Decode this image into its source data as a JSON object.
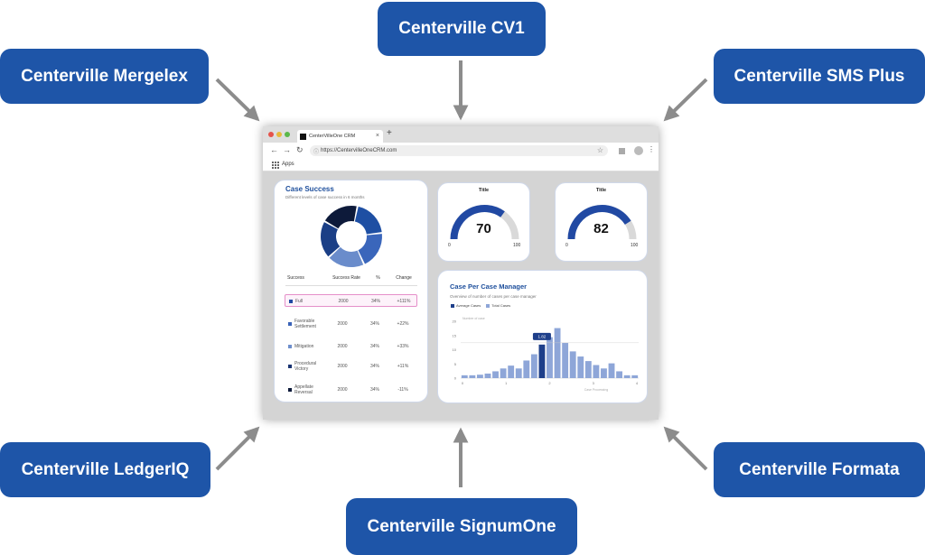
{
  "nodes": {
    "cv1": "Centerville CV1",
    "mergelex": "Centerville Mergelex",
    "sms_plus": "Centerville SMS Plus",
    "ledgeriq": "Centerville LedgerIQ",
    "signumone": "Centerville SignumOne",
    "formata": "Centerville Formata"
  },
  "colors": {
    "node": "#1e55a8",
    "arrow": "#8c8c8c",
    "accent": "#2149a3"
  },
  "browser": {
    "tab_title": "CenterVilleOne CRM",
    "tab_close": "×",
    "new_tab": "+",
    "url": "https://CentervilleOneCRM.com",
    "bookmarks_label": "Apps"
  },
  "case_success": {
    "title": "Case Success",
    "subtitle": "Different levels of case success in 6 months",
    "headers": [
      "Success",
      "Success Rate",
      "%",
      "Change"
    ],
    "rows": [
      {
        "label": "Full",
        "rate": "2000",
        "pct": "34%",
        "change": "+111%",
        "color": "#2149a3"
      },
      {
        "label": "Favorable Settlement",
        "rate": "2000",
        "pct": "34%",
        "change": "+22%",
        "color": "#3a63b8"
      },
      {
        "label": "Mitigation",
        "rate": "2000",
        "pct": "34%",
        "change": "+33%",
        "color": "#6f8fcc"
      },
      {
        "label": "Procedural Victory",
        "rate": "2000",
        "pct": "34%",
        "change": "+11%",
        "color": "#1a3472"
      },
      {
        "label": "Appellate Reversal",
        "rate": "2000",
        "pct": "34%",
        "change": "-11%",
        "color": "#0d1a3a"
      }
    ]
  },
  "gauges": [
    {
      "title": "Title",
      "value": "70",
      "min": "0",
      "max": "100"
    },
    {
      "title": "Title",
      "value": "82",
      "min": "0",
      "max": "100"
    }
  ],
  "case_per_manager": {
    "title": "Case Per Case Manager",
    "subtitle": "Overview of number of cases per case manager",
    "legend": [
      "Average Cases",
      "Total Cases"
    ],
    "tooltip": "1.82",
    "y_axis_note": "Number of case",
    "x_axis_note": "Case Processing"
  },
  "chart_data": [
    {
      "type": "pie",
      "title": "Case Success",
      "categories": [
        "Full",
        "Favorable Settlement",
        "Mitigation",
        "Procedural Victory",
        "Appellate Reversal"
      ],
      "values": [
        20,
        20,
        20,
        20,
        20
      ]
    },
    {
      "type": "bar",
      "title": "Case Per Case Manager",
      "series": [
        {
          "name": "Total Cases",
          "values": [
            1,
            1,
            1.2,
            1.6,
            2.4,
            3.4,
            4.4,
            3.4,
            6.2,
            8.4,
            11.8,
            14.4,
            17.6,
            12.4,
            9.4,
            7.6,
            6,
            4.6,
            3.4,
            5.2,
            2.4,
            1,
            1
          ]
        }
      ],
      "highlight_index": 10,
      "highlight_label": "1.82",
      "yticks": [
        "0",
        "5",
        "10",
        "15",
        "20"
      ],
      "xticks": [
        "0",
        "1",
        "2",
        "3",
        "4"
      ],
      "ylim": [
        0,
        20
      ]
    }
  ]
}
